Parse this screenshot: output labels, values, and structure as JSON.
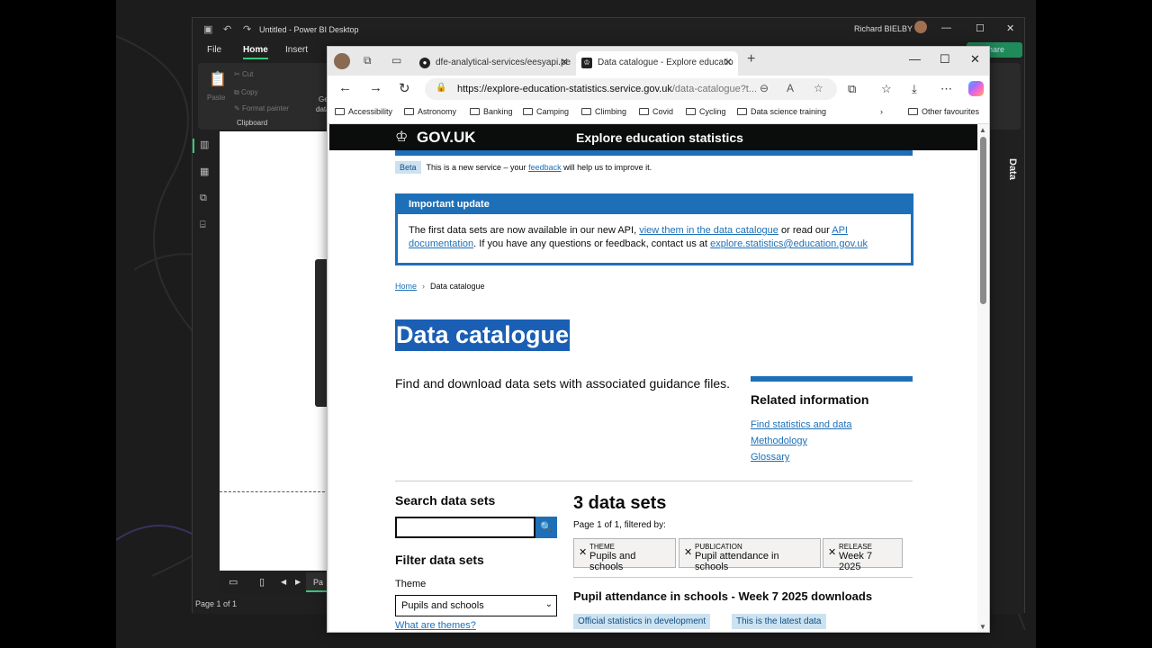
{
  "powerbi": {
    "title": "Untitled - Power BI Desktop",
    "user": "Richard BIELBY",
    "menu": [
      "File",
      "Home",
      "Insert"
    ],
    "ribbon": {
      "paste": "Paste",
      "cut": "Cut",
      "copy": "Copy",
      "format_painter": "Format painter",
      "clipboard": "Clipboard",
      "get_data_partial": "Ge",
      "data_partial": "data"
    },
    "share_label": "hare",
    "page_tab": "Pa",
    "status": "Page 1 of 1",
    "data_pane": "Data"
  },
  "browser": {
    "tabs": [
      {
        "label": "dfe-analytical-services/eesyapi.pe",
        "active": false
      },
      {
        "label": "Data catalogue - Explore educatio",
        "active": true
      }
    ],
    "url_host": "https://explore-education-statistics.service.gov.uk",
    "url_path": "/data-catalogue?t...",
    "favourites": [
      "Accessibility",
      "Astronomy",
      "Banking",
      "Camping",
      "Climbing",
      "Covid",
      "Cycling",
      "Data science training"
    ],
    "other_favourites": "Other favourites"
  },
  "page": {
    "gov_logo": "GOV.UK",
    "service": "Explore education statistics",
    "beta_tag": "Beta",
    "beta_pre": "This is a new service – your ",
    "beta_link": "feedback",
    "beta_post": " will help us to improve it.",
    "notice": {
      "heading": "Important update",
      "t1": "The first data sets are now available in our new API, ",
      "l1": "view them in the data catalogue",
      "t2": " or read our ",
      "l2": "API documentation",
      "t3": ". If you have any questions or feedback, contact us at ",
      "l3": "explore.statistics@education.gov.uk"
    },
    "breadcrumb": {
      "home": "Home",
      "current": "Data catalogue"
    },
    "title": "Data catalogue",
    "lead": "Find and download data sets with associated guidance files.",
    "related": {
      "heading": "Related information",
      "links": [
        "Find statistics and data",
        "Methodology",
        "Glossary"
      ]
    },
    "search_heading": "Search data sets",
    "search_value": "",
    "filter_heading": "Filter data sets",
    "theme_label": "Theme",
    "theme_value": "Pupils and schools",
    "what_themes": "What are themes?",
    "count": "3 data sets",
    "page_info": "Page 1 of 1, filtered by:",
    "chips": [
      {
        "key": "THEME",
        "value": "Pupils and schools"
      },
      {
        "key": "PUBLICATION",
        "value": "Pupil attendance in schools"
      },
      {
        "key": "RELEASE",
        "value": "Week 7 2025"
      }
    ],
    "downloads_heading": "Pupil attendance in schools - Week 7 2025 downloads",
    "badges": [
      "Official statistics in development",
      "This is the latest data"
    ]
  },
  "colors": {
    "gov_blue": "#1d70b8",
    "gov_black": "#0b0c0c",
    "pbi_green": "#35c87a",
    "selection": "#1a5fb4"
  }
}
